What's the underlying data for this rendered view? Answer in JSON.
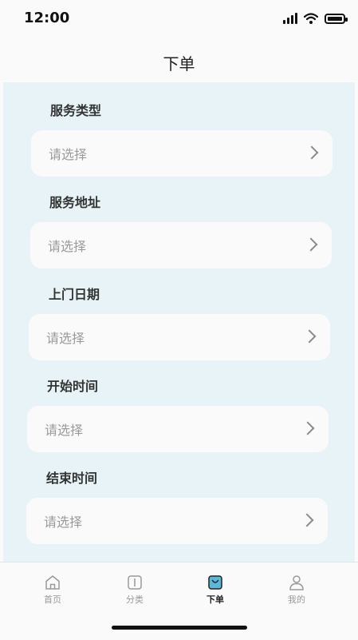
{
  "status_bar": {
    "time": "12:00"
  },
  "header": {
    "title": "下单"
  },
  "form": {
    "fields": [
      {
        "label": "服务类型",
        "placeholder": "请选择"
      },
      {
        "label": "服务地址",
        "placeholder": "请选择"
      },
      {
        "label": "上门日期",
        "placeholder": "请选择"
      },
      {
        "label": "开始时间",
        "placeholder": "请选择"
      },
      {
        "label": "结束时间",
        "placeholder": "请选择"
      }
    ]
  },
  "tab_bar": {
    "tabs": [
      {
        "label": "首页",
        "icon": "home-icon",
        "active": false
      },
      {
        "label": "分类",
        "icon": "book-icon",
        "active": false
      },
      {
        "label": "下单",
        "icon": "shopping-bag-icon",
        "active": true
      },
      {
        "label": "我的",
        "icon": "user-icon",
        "active": false
      }
    ],
    "active_color": "#5bb8d8"
  }
}
